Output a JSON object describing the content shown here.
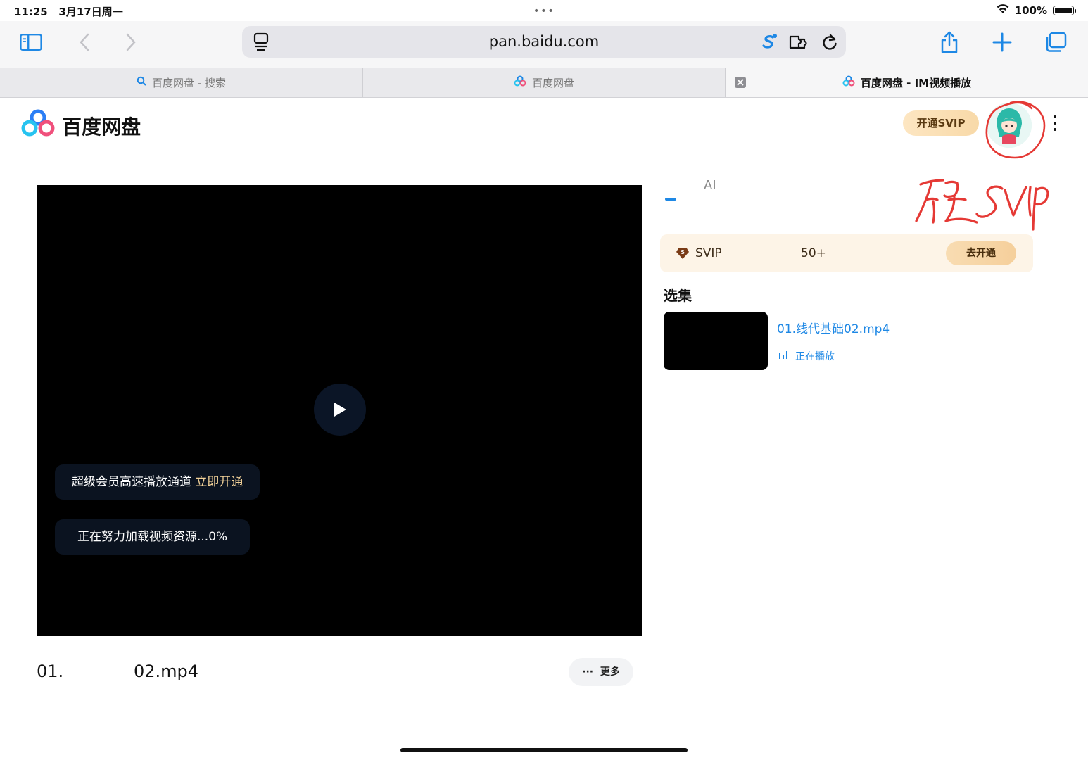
{
  "status": {
    "time": "11:25",
    "date": "3月17日周一",
    "dots": "•••",
    "battery": "100%"
  },
  "browser": {
    "url": "pan.baidu.com",
    "tabs": [
      {
        "label": "百度网盘 - 搜索"
      },
      {
        "label": "百度网盘"
      },
      {
        "label": "百度网盘 - IM视频播放"
      }
    ]
  },
  "header": {
    "logo_text": "百度网盘",
    "svip_button": "开通SVIP"
  },
  "player": {
    "promo_text": "超级会员高速播放通道",
    "promo_link": "立即开通",
    "loading_text": "正在努力加载视频资源...0%"
  },
  "video_info": {
    "title_prefix": "01.",
    "title_suffix": "02.mp4",
    "more_label": "更多"
  },
  "side": {
    "ai_tab": "AI",
    "annotation": "現SVIP",
    "svip_card": {
      "label": "SVIP",
      "count": "50+",
      "button": "去开通"
    },
    "section_title": "选集",
    "episodes": [
      {
        "name": "01.线代基础02.mp4",
        "status": "正在播放"
      }
    ]
  },
  "colors": {
    "accent": "#1e88e5",
    "annotation_red": "#e53935",
    "svip_gold": "#f8d9a8"
  }
}
